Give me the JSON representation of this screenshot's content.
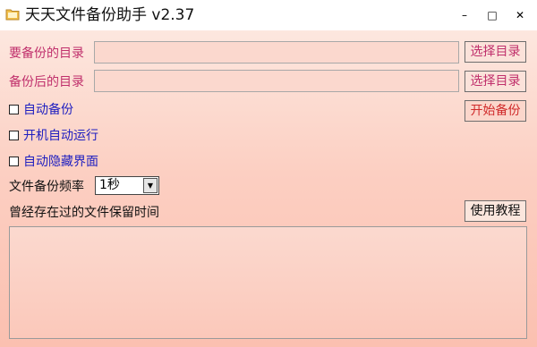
{
  "window": {
    "title": "天天文件备份助手 v2.37",
    "controls": {
      "minimize": "–",
      "maximize": "□",
      "close": "✕"
    }
  },
  "form": {
    "source_label": "要备份的目录",
    "source_value": "",
    "dest_label": "备份后的目录",
    "dest_value": "",
    "select_dir_button": "选择目录",
    "select_dir_button2": "选择目录",
    "start_button": "开始备份",
    "auto_backup_label": "自动备份",
    "autostart_label": "开机自动运行",
    "auto_hide_label": "自动隐藏界面",
    "frequency_label": "文件备份频率",
    "frequency_value": "1秒",
    "tutorial_button": "使用教程",
    "retention_label": "曾经存在过的文件保留时间",
    "auto_backup_checked": false,
    "autostart_checked": false,
    "auto_hide_checked": false
  },
  "colors": {
    "pink_label": "#c0306c",
    "blue_label": "#2020c0",
    "start_button_text": "#d02b2b",
    "background_top": "#fde7df",
    "background_bottom": "#fbc0b0"
  }
}
